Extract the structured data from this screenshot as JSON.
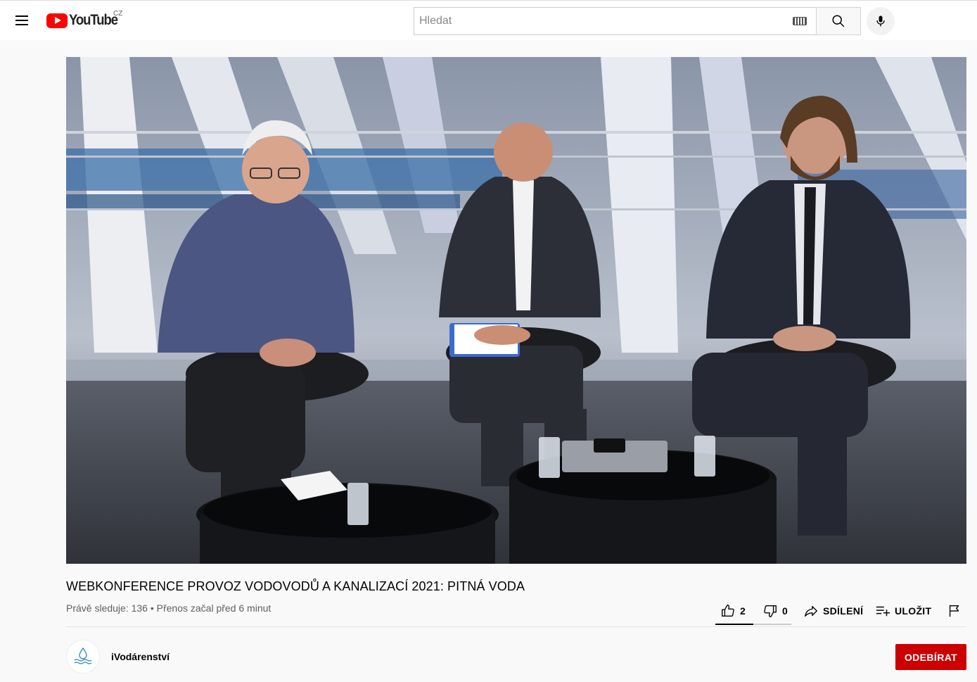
{
  "header": {
    "logo_text": "YouTube",
    "country_code": "CZ",
    "search_placeholder": "Hledat"
  },
  "video": {
    "title": "WEBKONFERENCE PROVOZ VODOVODŮ A KANALIZACÍ 2021: PITNÁ VODA",
    "meta": "Právě sleduje: 136 • Přenos začal před 6 minut"
  },
  "actions": {
    "like_count": "2",
    "dislike_count": "0",
    "share_label": "SDÍLENÍ",
    "save_label": "ULOŽIT",
    "like_ratio": 0.5
  },
  "channel": {
    "name": "iVodárenství",
    "subscribe_label": "ODEBÍRAT"
  },
  "colors": {
    "brand_red": "#ff0000",
    "subscribe_red": "#cc0000",
    "meta_gray": "#606060"
  }
}
